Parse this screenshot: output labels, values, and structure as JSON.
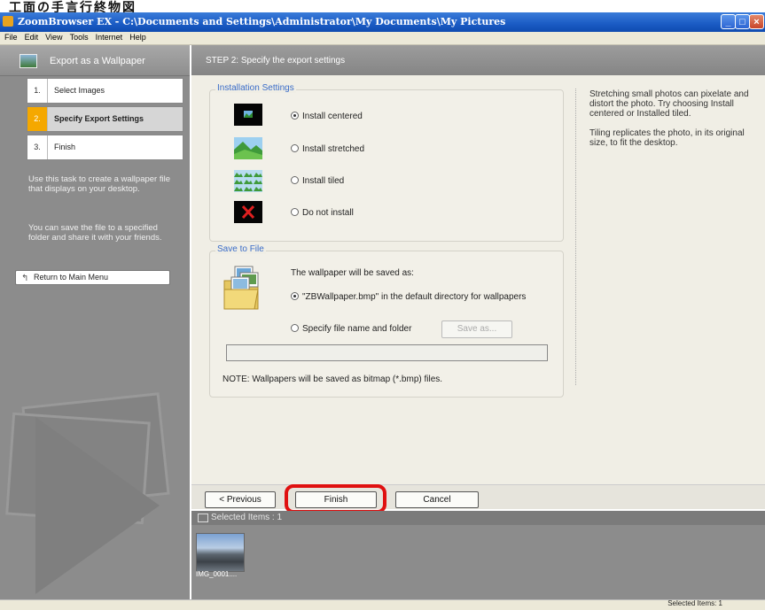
{
  "doc_header": "工面の手言行終物図",
  "window": {
    "title": "ZoomBrowser EX  -  C:\\Documents and Settings\\Administrator\\My Documents\\My Pictures",
    "buttons": [
      "minimize",
      "maximize",
      "close"
    ]
  },
  "menu": [
    "File",
    "Edit",
    "View",
    "Tools",
    "Internet",
    "Help"
  ],
  "sidebar": {
    "header": "Export as a Wallpaper",
    "steps": [
      {
        "num": "1.",
        "label": "Select Images",
        "active": false
      },
      {
        "num": "2.",
        "label": "Specify Export Settings",
        "active": true
      },
      {
        "num": "3.",
        "label": "Finish",
        "active": false
      }
    ],
    "desc1": "Use this task to create a wallpaper file that displays on your desktop.",
    "desc2": "You can save the file to a specified folder and share it with your friends.",
    "return_label": "Return to Main Menu"
  },
  "main": {
    "header": "STEP 2: Specify the export settings",
    "installation": {
      "title": "Installation Settings",
      "options": [
        {
          "label": "Install centered",
          "selected": true,
          "icon": "centered-wallpaper-icon"
        },
        {
          "label": "Install stretched",
          "selected": false,
          "icon": "stretched-wallpaper-icon"
        },
        {
          "label": "Install tiled",
          "selected": false,
          "icon": "tiled-wallpaper-icon"
        },
        {
          "label": "Do not install",
          "selected": false,
          "icon": "do-not-install-icon"
        }
      ]
    },
    "save": {
      "title": "Save to File",
      "intro": "The wallpaper will be saved as:",
      "option_default": "\"ZBWallpaper.bmp\" in the default directory for wallpapers",
      "option_specify": "Specify file name and folder",
      "save_as": "Save as...",
      "path_value": "",
      "note": "NOTE: Wallpapers will be saved as bitmap (*.bmp) files."
    },
    "help1": "Stretching small photos can pixelate and distort the photo. Try choosing Install centered or Installed tiled.",
    "help2": "Tiling replicates the photo, in its original size, to fit the desktop."
  },
  "buttons": {
    "previous": "< Previous",
    "finish": "Finish",
    "cancel": "Cancel"
  },
  "selected": {
    "header": "Selected Items : 1",
    "thumb_name": "IMG_0001...."
  },
  "status": "Selected Items: 1",
  "colors": {
    "accent": "#3a6cc8",
    "highlight": "#e01010",
    "step_active": "#f5a800",
    "titlebar": "#1a5bc4"
  }
}
